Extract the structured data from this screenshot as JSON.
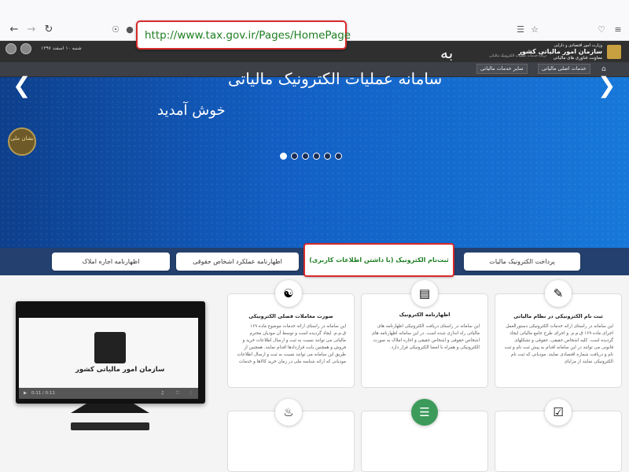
{
  "browser": {
    "url": "http://www.tax.gov.ir/Pages/HomePage"
  },
  "header": {
    "org_name": "سازمان امور مالیاتی کشور",
    "org_sub": "معاونت فناوری های مالیاتی",
    "ministry": "وزارت امور اقتصادی و دارایی",
    "portal": "درگاه خدمات عملیات الکترونیک مالیاتی",
    "date": "شنبه ۱۰ اسفند ۱۳۹۷"
  },
  "menu": {
    "main_services": "خدمات اصلی مالیاتی",
    "other_services": "سایر خدمات مالیاتی"
  },
  "hero": {
    "line1": "به",
    "line2": "سامانه عملیات الکترونیک مالیاتی",
    "line3": "خوش آمدید",
    "seal_text": "نشان ملی"
  },
  "services": {
    "pay": "پرداخت الکترونیک مالیات",
    "register": "ثبت‌نام الکترونیک (با داشتن اطلاعات کاربری)",
    "legal": "اظهارنامه عملکرد اشخاص حقوقی",
    "rent": "اظهارنامه اجاره املاک"
  },
  "video": {
    "title": "سازمان امور مالیاتی کشور",
    "time": "0:11 / 0:11"
  },
  "cards": [
    {
      "title": "ثبت نام  الکترونیکی در نظام مالیاتی",
      "text": "این سامانه در راستای ارائه خدمات الکترونیکی دستورالعمل اجرای ماده ۱۶۹ ق.م.م. و اجرای طرح جامع مالیاتی ایجاد گردیده است. کلیه اشخاص حقیقی، حقوقی و تشکلهای قانونی می توانند در این سامانه اقدام به پیش ثبت نام و ثبت نام و دریافت شماره اقتصادی نمایند. مودیانی که ثبت نام الکترونیکی نمایند از مزایای"
    },
    {
      "title": "اظهارنامه الکترونیک",
      "text": "این سامانه در راستای دریافت الکترونیکی اظهارنامه های مالیاتی راه اندازی شده است. در این سامانه اظهارنامه های اشخاص حقوقی و اشخاص حقیقی و اجاره املاک به صورت الکترونیکی و همراه با امضا الکترونیکی قرار دارد."
    },
    {
      "title": "صورت معاملات فصلی الکترونیکی",
      "text": "این سامانه در راستای ارائه خدمات موضوع ماده ۱۶۹ ق.م.م. ایجاد گردیده است و توسط آن مودیان محترم مالیاتی می توانند نسبت به ثبت و ارسال اطلاعات خرید و فروش و همچنین بابت قراردادها اقدام نمایند. همچنین از طریق این سامانه می توانند نسبت به ثبت و ارسال اطلاعات مودیانی که ارائه شناسه ملی در زمان خرید کالاها و خدمات"
    }
  ]
}
